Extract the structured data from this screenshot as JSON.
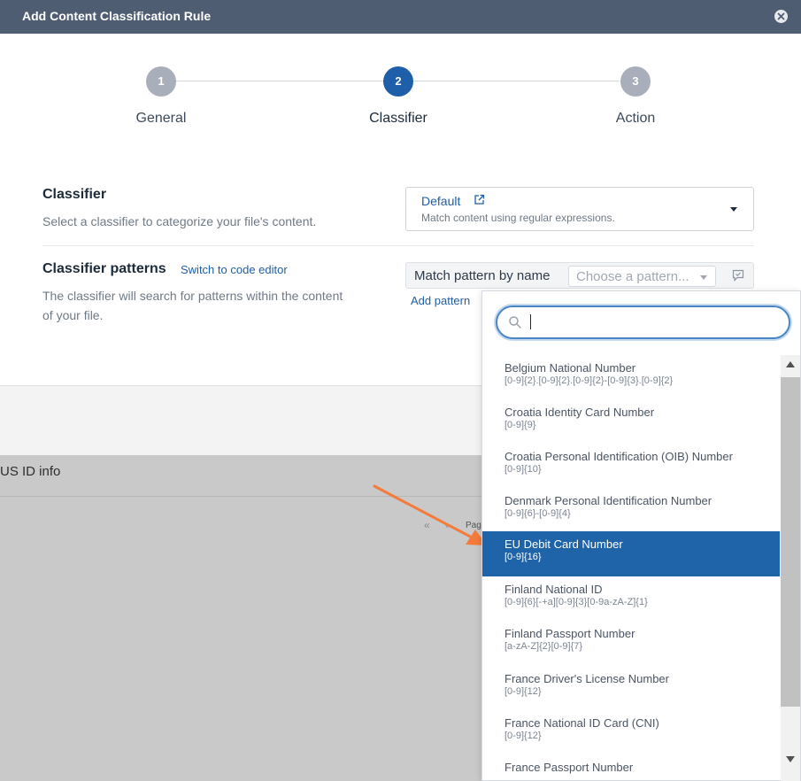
{
  "dialog": {
    "title": "Add Content Classification Rule"
  },
  "stepper": {
    "steps": [
      {
        "number": "1",
        "label": "General",
        "active": false
      },
      {
        "number": "2",
        "label": "Classifier",
        "active": true
      },
      {
        "number": "3",
        "label": "Action",
        "active": false
      }
    ]
  },
  "classifier": {
    "title": "Classifier",
    "description": "Select a classifier to categorize your file's content.",
    "selected_value": "Default",
    "selected_subtext": "Match content using regular expressions."
  },
  "patterns": {
    "title": "Classifier patterns",
    "switch_link": "Switch to code editor",
    "description_line1": "The classifier will search for patterns within the content",
    "description_line2": "of your file.",
    "match_label": "Match pattern by name",
    "chooser_placeholder": "Choose a pattern...",
    "add_pattern": "Add pattern"
  },
  "dropdown": {
    "search_value": "",
    "items": [
      {
        "name": "Belgium National Number",
        "pattern": "[0-9]{2}.[0-9]{2}.[0-9]{2}-[0-9]{3}.[0-9]{2}",
        "selected": false
      },
      {
        "name": "Croatia Identity Card Number",
        "pattern": "[0-9]{9}",
        "selected": false
      },
      {
        "name": "Croatia Personal Identification (OIB) Number",
        "pattern": "[0-9]{10}",
        "selected": false
      },
      {
        "name": "Denmark Personal Identification Number",
        "pattern": "[0-9]{6}-[0-9]{4}",
        "selected": false
      },
      {
        "name": "EU Debit Card Number",
        "pattern": "[0-9]{16}",
        "selected": true
      },
      {
        "name": "Finland National ID",
        "pattern": "[0-9]{6}[-+a][0-9]{3}[0-9a-zA-Z]{1}",
        "selected": false
      },
      {
        "name": "Finland Passport Number",
        "pattern": "[a-zA-Z]{2}[0-9]{7}",
        "selected": false
      },
      {
        "name": "France Driver's License Number",
        "pattern": "[0-9]{12}",
        "selected": false
      },
      {
        "name": "France National ID Card (CNI)",
        "pattern": "[0-9]{12}",
        "selected": false
      },
      {
        "name": "France Passport Number",
        "pattern": "",
        "selected": false
      }
    ]
  },
  "background": {
    "column_text": "US ID info",
    "pager_prev": "«",
    "pager_sep": "‹",
    "page_text": "Pag"
  },
  "colors": {
    "header_bg": "#4f5d73",
    "accent": "#1f5ea8",
    "selected_row": "#1f63a8",
    "annotation_arrow": "#f47b3c"
  },
  "icons": {
    "close": "close-icon",
    "external_link": "external-link-icon",
    "dropdown_caret": "chevron-down-icon",
    "comment": "comment-icon",
    "search": "search-icon",
    "annotation": "arrow-annotation"
  }
}
